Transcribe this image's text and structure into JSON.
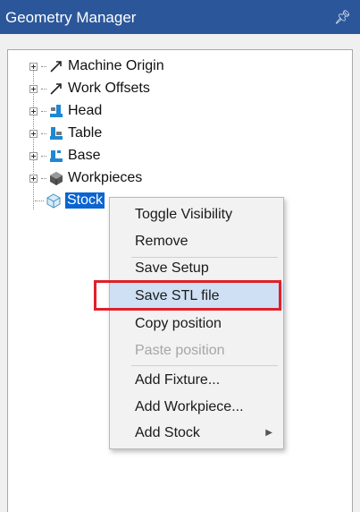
{
  "window": {
    "title": "Geometry Manager",
    "pin_icon": "pin-icon"
  },
  "tree": {
    "items": [
      {
        "label": "Machine Origin",
        "icon": "axis-arrow-icon"
      },
      {
        "label": "Work Offsets",
        "icon": "axis-arrow-icon"
      },
      {
        "label": "Head",
        "icon": "machine-head-icon"
      },
      {
        "label": "Table",
        "icon": "machine-table-icon"
      },
      {
        "label": "Base",
        "icon": "machine-base-icon"
      },
      {
        "label": "Workpieces",
        "icon": "workpieces-icon"
      },
      {
        "label": "Stock",
        "icon": "stock-cube-icon",
        "selected": true
      }
    ]
  },
  "context_menu": {
    "items": [
      {
        "label": "Toggle Visibility"
      },
      {
        "label": "Remove"
      },
      {
        "label": "Save Setup"
      },
      {
        "label": "Save STL file",
        "highlighted": true
      },
      {
        "label": "Copy position"
      },
      {
        "label": "Paste position",
        "disabled": true
      },
      {
        "label": "Add Fixture..."
      },
      {
        "label": "Add Workpiece..."
      },
      {
        "label": "Add Stock",
        "has_submenu": true
      }
    ]
  },
  "colors": {
    "titlebar": "#2b579a",
    "selection": "#0a64d2",
    "menu_highlight": "#cfe0f4",
    "annotation_box": "#e0202a"
  }
}
